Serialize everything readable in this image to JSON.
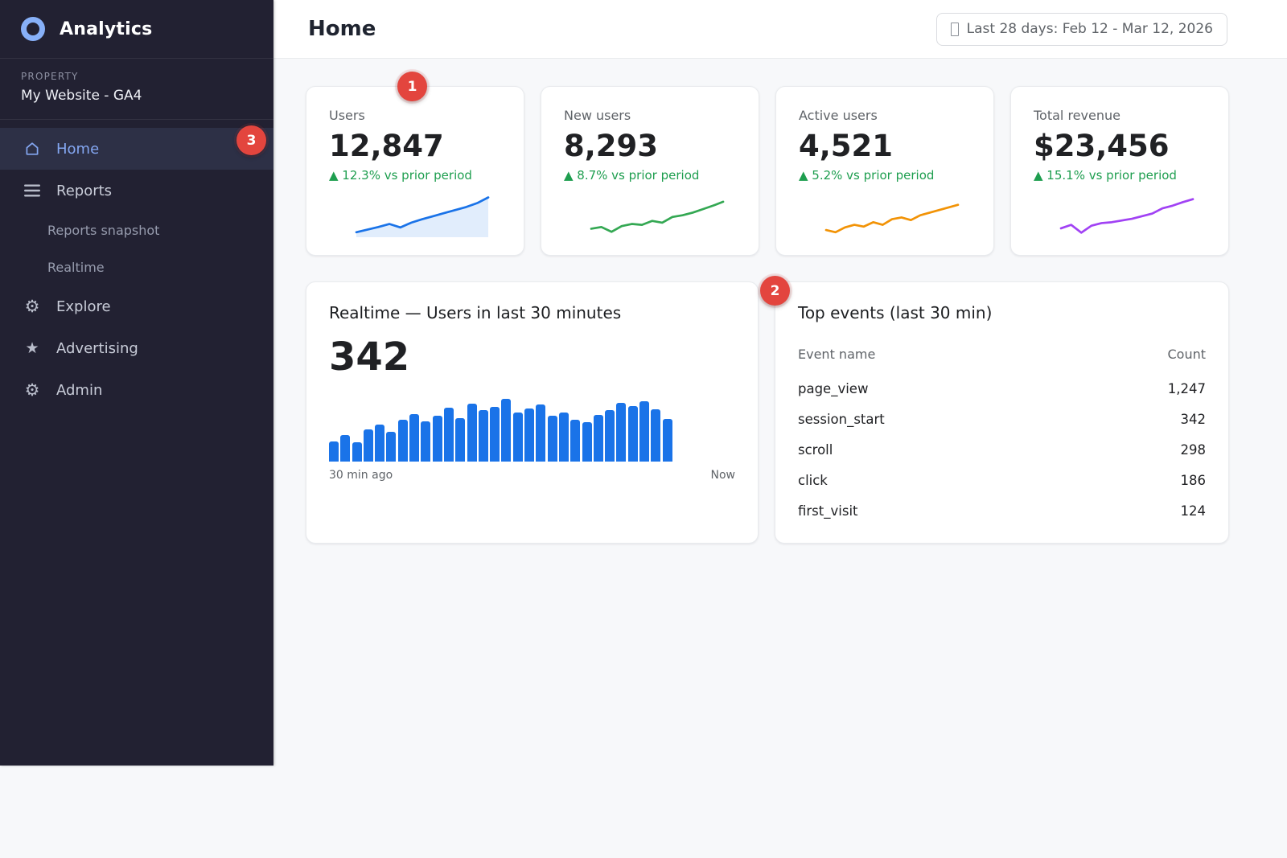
{
  "app": {
    "title": "Analytics"
  },
  "sidebar": {
    "property_label": "PROPERTY",
    "property_name": "My Website - GA4",
    "items": [
      {
        "id": "home",
        "label": "Home",
        "icon": "home-icon",
        "active": true,
        "badge": "3"
      },
      {
        "id": "reports",
        "label": "Reports",
        "icon": "menu-icon"
      },
      {
        "id": "reports-snapshot",
        "label": "Reports snapshot",
        "sub": true
      },
      {
        "id": "realtime",
        "label": "Realtime",
        "sub": true
      },
      {
        "id": "explore",
        "label": "Explore",
        "icon": "gear-icon"
      },
      {
        "id": "advertising",
        "label": "Advertising",
        "icon": "star-icon"
      },
      {
        "id": "admin",
        "label": "Admin",
        "icon": "gear-icon"
      }
    ]
  },
  "header": {
    "title": "Home",
    "date_icon": "calendar-placeholder-icon",
    "date_range": "Last 28 days: Feb 12 - Mar 12, 2026"
  },
  "kpis": [
    {
      "id": "users",
      "label": "Users",
      "value": "12,847",
      "delta": "▲ 12.3% vs prior period",
      "delta_color": "#1e9e4f",
      "color": "#1a73e8",
      "filled": true,
      "badge": "1",
      "spark": [
        8,
        14,
        20,
        27,
        19,
        30,
        38,
        45,
        52,
        59,
        66,
        75,
        88
      ]
    },
    {
      "id": "new-users",
      "label": "New users",
      "value": "8,293",
      "delta": "▲ 8.7% vs prior period",
      "delta_color": "#1e9e4f",
      "color": "#34a853",
      "filled": false,
      "spark": [
        16,
        20,
        9,
        22,
        27,
        25,
        34,
        30,
        43,
        47,
        53,
        61,
        69,
        78
      ]
    },
    {
      "id": "active-users",
      "label": "Active users",
      "value": "4,521",
      "delta": "▲ 5.2% vs prior period",
      "delta_color": "#1e9e4f",
      "color": "#f29306",
      "filled": false,
      "spark": [
        13,
        8,
        19,
        25,
        21,
        31,
        25,
        38,
        42,
        36,
        47,
        53,
        59,
        65,
        71
      ]
    },
    {
      "id": "total-revenue",
      "label": "Total revenue",
      "value": "$23,456",
      "delta": "▲ 15.1% vs prior period",
      "delta_color": "#1e9e4f",
      "color": "#a142f4",
      "filled": false,
      "spark": [
        17,
        25,
        7,
        23,
        29,
        31,
        35,
        39,
        45,
        51,
        63,
        69,
        77,
        84
      ]
    }
  ],
  "realtime": {
    "title": "Realtime — Users in last 30 minutes",
    "value": "342",
    "axis_left": "30 min ago",
    "axis_right": "Now",
    "bar_color": "#1a73e8",
    "bars": [
      32,
      41,
      30,
      50,
      58,
      47,
      65,
      74,
      63,
      71,
      84,
      68,
      90,
      80,
      85,
      98,
      76,
      83,
      89,
      71,
      77,
      65,
      61,
      73,
      80,
      92,
      86,
      94,
      82,
      66
    ]
  },
  "top_events": {
    "title": "Top events (last 30 min)",
    "badge": "2",
    "columns": [
      "Event name",
      "Count"
    ],
    "rows": [
      {
        "name": "page_view",
        "count": "1,247"
      },
      {
        "name": "session_start",
        "count": "342"
      },
      {
        "name": "scroll",
        "count": "298"
      },
      {
        "name": "click",
        "count": "186"
      },
      {
        "name": "first_visit",
        "count": "124"
      }
    ]
  }
}
